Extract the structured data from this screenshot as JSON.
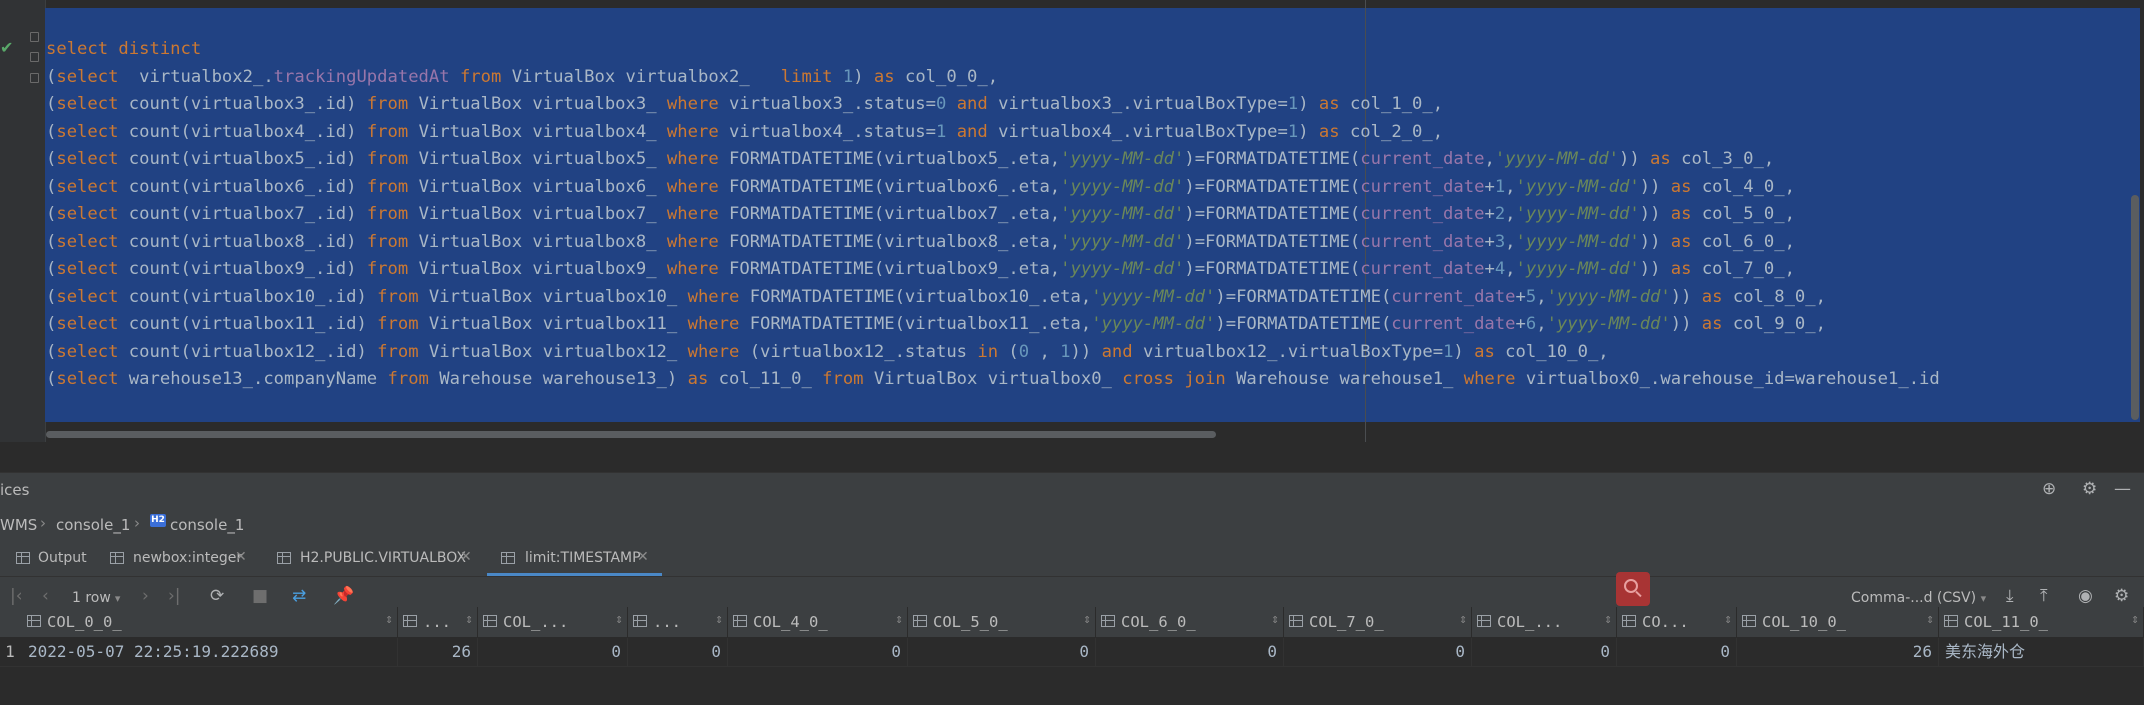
{
  "editor": {
    "lines": [
      [
        [
          "kw",
          "select distinct"
        ]
      ],
      [
        [
          "p",
          "("
        ],
        [
          "kw",
          "select"
        ],
        [
          "p",
          "  virtualbox2_."
        ],
        [
          "fn",
          "trackingUpdatedAt"
        ],
        [
          "p",
          " "
        ],
        [
          "kw",
          "from"
        ],
        [
          "p",
          " VirtualBox virtualbox2_   "
        ],
        [
          "kw",
          "limit"
        ],
        [
          "p",
          " "
        ],
        [
          "num",
          "1"
        ],
        [
          "p",
          ") "
        ],
        [
          "kw",
          "as"
        ],
        [
          "p",
          " col_0_0_,"
        ]
      ],
      [
        [
          "p",
          "("
        ],
        [
          "kw",
          "select"
        ],
        [
          "p",
          " count(virtualbox3_.id) "
        ],
        [
          "kw",
          "from"
        ],
        [
          "p",
          " VirtualBox virtualbox3_ "
        ],
        [
          "kw",
          "where"
        ],
        [
          "p",
          " virtualbox3_.status="
        ],
        [
          "num",
          "0"
        ],
        [
          "p",
          " "
        ],
        [
          "kw",
          "and"
        ],
        [
          "p",
          " virtualbox3_.virtualBoxType="
        ],
        [
          "num",
          "1"
        ],
        [
          "p",
          ") "
        ],
        [
          "kw",
          "as"
        ],
        [
          "p",
          " col_1_0_,"
        ]
      ],
      [
        [
          "p",
          "("
        ],
        [
          "kw",
          "select"
        ],
        [
          "p",
          " count(virtualbox4_.id) "
        ],
        [
          "kw",
          "from"
        ],
        [
          "p",
          " VirtualBox virtualbox4_ "
        ],
        [
          "kw",
          "where"
        ],
        [
          "p",
          " virtualbox4_.status="
        ],
        [
          "num",
          "1"
        ],
        [
          "p",
          " "
        ],
        [
          "kw",
          "and"
        ],
        [
          "p",
          " virtualbox4_.virtualBoxType="
        ],
        [
          "num",
          "1"
        ],
        [
          "p",
          ") "
        ],
        [
          "kw",
          "as"
        ],
        [
          "p",
          " col_2_0_,"
        ]
      ],
      [
        [
          "p",
          "("
        ],
        [
          "kw",
          "select"
        ],
        [
          "p",
          " count(virtualbox5_.id) "
        ],
        [
          "kw",
          "from"
        ],
        [
          "p",
          " VirtualBox virtualbox5_ "
        ],
        [
          "kw",
          "where"
        ],
        [
          "p",
          " FORMATDATETIME(virtualbox5_.eta,"
        ],
        [
          "str",
          "'yyyy-MM-dd'"
        ],
        [
          "p",
          ")=FORMATDATETIME("
        ],
        [
          "fn",
          "current_date"
        ],
        [
          "p",
          ","
        ],
        [
          "str",
          "'yyyy-MM-dd'"
        ],
        [
          "p",
          ")) "
        ],
        [
          "kw",
          "as"
        ],
        [
          "p",
          " col_3_0_,"
        ]
      ],
      [
        [
          "p",
          "("
        ],
        [
          "kw",
          "select"
        ],
        [
          "p",
          " count(virtualbox6_.id) "
        ],
        [
          "kw",
          "from"
        ],
        [
          "p",
          " VirtualBox virtualbox6_ "
        ],
        [
          "kw",
          "where"
        ],
        [
          "p",
          " FORMATDATETIME(virtualbox6_.eta,"
        ],
        [
          "str",
          "'yyyy-MM-dd'"
        ],
        [
          "p",
          ")=FORMATDATETIME("
        ],
        [
          "fn",
          "current_date"
        ],
        [
          "p",
          "+"
        ],
        [
          "num",
          "1"
        ],
        [
          "p",
          ","
        ],
        [
          "str",
          "'yyyy-MM-dd'"
        ],
        [
          "p",
          ")) "
        ],
        [
          "kw",
          "as"
        ],
        [
          "p",
          " col_4_0_,"
        ]
      ],
      [
        [
          "p",
          "("
        ],
        [
          "kw",
          "select"
        ],
        [
          "p",
          " count(virtualbox7_.id) "
        ],
        [
          "kw",
          "from"
        ],
        [
          "p",
          " VirtualBox virtualbox7_ "
        ],
        [
          "kw",
          "where"
        ],
        [
          "p",
          " FORMATDATETIME(virtualbox7_.eta,"
        ],
        [
          "str",
          "'yyyy-MM-dd'"
        ],
        [
          "p",
          ")=FORMATDATETIME("
        ],
        [
          "fn",
          "current_date"
        ],
        [
          "p",
          "+"
        ],
        [
          "num",
          "2"
        ],
        [
          "p",
          ","
        ],
        [
          "str",
          "'yyyy-MM-dd'"
        ],
        [
          "p",
          ")) "
        ],
        [
          "kw",
          "as"
        ],
        [
          "p",
          " col_5_0_,"
        ]
      ],
      [
        [
          "p",
          "("
        ],
        [
          "kw",
          "select"
        ],
        [
          "p",
          " count(virtualbox8_.id) "
        ],
        [
          "kw",
          "from"
        ],
        [
          "p",
          " VirtualBox virtualbox8_ "
        ],
        [
          "kw",
          "where"
        ],
        [
          "p",
          " FORMATDATETIME(virtualbox8_.eta,"
        ],
        [
          "str",
          "'yyyy-MM-dd'"
        ],
        [
          "p",
          ")=FORMATDATETIME("
        ],
        [
          "fn",
          "current_date"
        ],
        [
          "p",
          "+"
        ],
        [
          "num",
          "3"
        ],
        [
          "p",
          ","
        ],
        [
          "str",
          "'yyyy-MM-dd'"
        ],
        [
          "p",
          ")) "
        ],
        [
          "kw",
          "as"
        ],
        [
          "p",
          " col_6_0_,"
        ]
      ],
      [
        [
          "p",
          "("
        ],
        [
          "kw",
          "select"
        ],
        [
          "p",
          " count(virtualbox9_.id) "
        ],
        [
          "kw",
          "from"
        ],
        [
          "p",
          " VirtualBox virtualbox9_ "
        ],
        [
          "kw",
          "where"
        ],
        [
          "p",
          " FORMATDATETIME(virtualbox9_.eta,"
        ],
        [
          "str",
          "'yyyy-MM-dd'"
        ],
        [
          "p",
          ")=FORMATDATETIME("
        ],
        [
          "fn",
          "current_date"
        ],
        [
          "p",
          "+"
        ],
        [
          "num",
          "4"
        ],
        [
          "p",
          ","
        ],
        [
          "str",
          "'yyyy-MM-dd'"
        ],
        [
          "p",
          ")) "
        ],
        [
          "kw",
          "as"
        ],
        [
          "p",
          " col_7_0_,"
        ]
      ],
      [
        [
          "p",
          "("
        ],
        [
          "kw",
          "select"
        ],
        [
          "p",
          " count(virtualbox10_.id) "
        ],
        [
          "kw",
          "from"
        ],
        [
          "p",
          " VirtualBox virtualbox10_ "
        ],
        [
          "kw",
          "where"
        ],
        [
          "p",
          " FORMATDATETIME(virtualbox10_.eta,"
        ],
        [
          "str",
          "'yyyy-MM-dd'"
        ],
        [
          "p",
          ")=FORMATDATETIME("
        ],
        [
          "fn",
          "current_date"
        ],
        [
          "p",
          "+"
        ],
        [
          "num",
          "5"
        ],
        [
          "p",
          ","
        ],
        [
          "str",
          "'yyyy-MM-dd'"
        ],
        [
          "p",
          ")) "
        ],
        [
          "kw",
          "as"
        ],
        [
          "p",
          " col_8_0_,"
        ]
      ],
      [
        [
          "p",
          "("
        ],
        [
          "kw",
          "select"
        ],
        [
          "p",
          " count(virtualbox11_.id) "
        ],
        [
          "kw",
          "from"
        ],
        [
          "p",
          " VirtualBox virtualbox11_ "
        ],
        [
          "kw",
          "where"
        ],
        [
          "p",
          " FORMATDATETIME(virtualbox11_.eta,"
        ],
        [
          "str",
          "'yyyy-MM-dd'"
        ],
        [
          "p",
          ")=FORMATDATETIME("
        ],
        [
          "fn",
          "current_date"
        ],
        [
          "p",
          "+"
        ],
        [
          "num",
          "6"
        ],
        [
          "p",
          ","
        ],
        [
          "str",
          "'yyyy-MM-dd'"
        ],
        [
          "p",
          ")) "
        ],
        [
          "kw",
          "as"
        ],
        [
          "p",
          " col_9_0_,"
        ]
      ],
      [
        [
          "p",
          "("
        ],
        [
          "kw",
          "select"
        ],
        [
          "p",
          " count(virtualbox12_.id) "
        ],
        [
          "kw",
          "from"
        ],
        [
          "p",
          " VirtualBox virtualbox12_ "
        ],
        [
          "kw",
          "where"
        ],
        [
          "p",
          " (virtualbox12_.status "
        ],
        [
          "kw",
          "in"
        ],
        [
          "p",
          " ("
        ],
        [
          "num",
          "0"
        ],
        [
          "p",
          " , "
        ],
        [
          "num",
          "1"
        ],
        [
          "p",
          ")) "
        ],
        [
          "kw",
          "and"
        ],
        [
          "p",
          " virtualbox12_.virtualBoxType="
        ],
        [
          "num",
          "1"
        ],
        [
          "p",
          ") "
        ],
        [
          "kw",
          "as"
        ],
        [
          "p",
          " col_10_0_,"
        ]
      ],
      [
        [
          "p",
          "("
        ],
        [
          "kw",
          "select"
        ],
        [
          "p",
          " warehouse13_.companyName "
        ],
        [
          "kw",
          "from"
        ],
        [
          "p",
          " Warehouse warehouse13_) "
        ],
        [
          "kw",
          "as"
        ],
        [
          "p",
          " col_11_0_ "
        ],
        [
          "kw",
          "from"
        ],
        [
          "p",
          " VirtualBox virtualbox0_ "
        ],
        [
          "kw",
          "cross join"
        ],
        [
          "p",
          " Warehouse warehouse1_ "
        ],
        [
          "kw",
          "where"
        ],
        [
          "p",
          " virtualbox0_.warehouse_id=warehouse1_.id"
        ]
      ]
    ]
  },
  "panel": {
    "title": "ices"
  },
  "breadcrumb": {
    "root": "WMS",
    "item1": "console_1",
    "badge": "H2",
    "item2": "console_1"
  },
  "tabs": [
    {
      "label": "Output"
    },
    {
      "label": "newbox:integer"
    },
    {
      "label": "H2.PUBLIC.VIRTUALBOX"
    },
    {
      "label": "limit:TIMESTAMP"
    }
  ],
  "toolbar": {
    "rows_label": "1 row",
    "format_label": "Comma-...d (CSV)"
  },
  "grid": {
    "columns": [
      "COL_0_0_",
      "...",
      "COL_...",
      "...",
      "COL_4_0_",
      "COL_5_0_",
      "COL_6_0_",
      "COL_7_0_",
      "COL_...",
      "CO...",
      "COL_10_0_",
      "COL_11_0_"
    ],
    "rows": [
      {
        "num": "1",
        "cells": [
          "2022-05-07 22:25:19.222689",
          "26",
          "0",
          "0",
          "0",
          "0",
          "0",
          "0",
          "0",
          "0",
          "26",
          "美东海外仓"
        ]
      }
    ]
  },
  "colors": {
    "selection": "#214283",
    "keyword": "#cc7832",
    "number": "#6897bb",
    "string": "#6a8759",
    "field": "#9876aa",
    "active_tab": "#4a88c7",
    "search_highlight": "#a83434"
  }
}
